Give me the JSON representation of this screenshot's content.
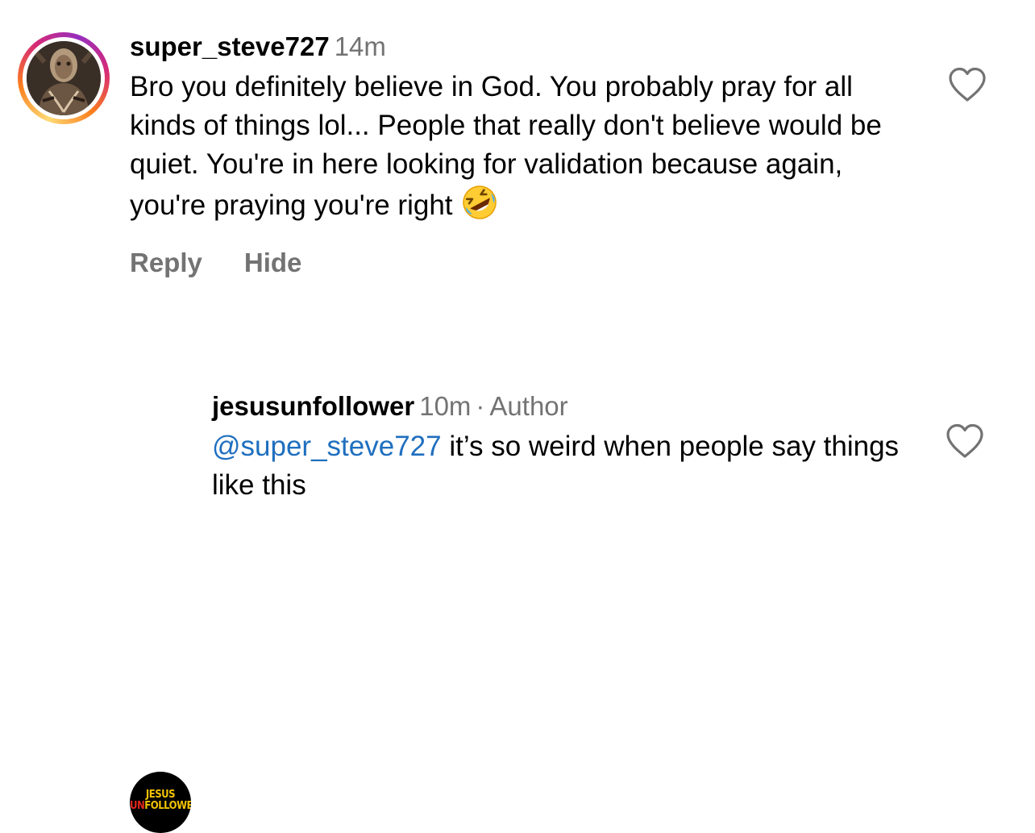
{
  "comments": [
    {
      "username": "super_steve727",
      "time": "14m",
      "text": "Bro you definitely believe in God. You probably pray for all kinds of things lol... People that really don't believe would be quiet. You're in here looking for validation because again, you're praying you're right",
      "emoji": "rolling-on-floor-laughing-emoji",
      "actions": {
        "reply": "Reply",
        "hide": "Hide"
      },
      "avatar": "tattoo-photo-avatar",
      "story_ring_colors": [
        "#feda75",
        "#fa7e1e",
        "#d62976",
        "#962fbf"
      ],
      "like_icon": "heart-outline-icon"
    },
    {
      "username": "jesusunfollower",
      "time": "10m",
      "separator": "·",
      "role": "Author",
      "mention": "@super_steve727",
      "text": " it’s so weird when people say things like this",
      "avatar_logo": {
        "line1": "JESUS",
        "line2_accent": "UN",
        "line2_rest": "FOLLOWER"
      },
      "like_icon": "heart-outline-icon"
    }
  ],
  "colors": {
    "text": "#000000",
    "secondary": "#737373",
    "mention": "#1f6fbf",
    "logo_yellow": "#f2c200",
    "logo_red": "#e2261c"
  }
}
